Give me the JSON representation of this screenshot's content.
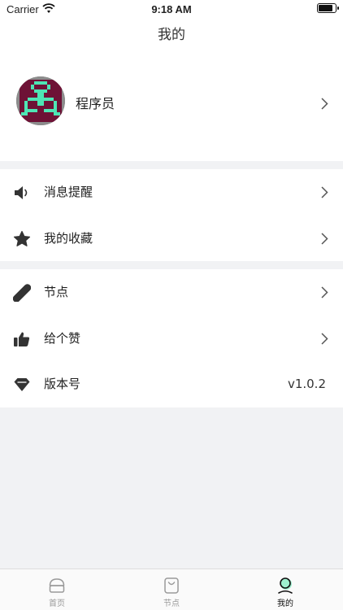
{
  "status_bar": {
    "carrier": "Carrier",
    "time": "9:18 AM"
  },
  "nav": {
    "title": "我的"
  },
  "profile": {
    "name": "程序员"
  },
  "menu": {
    "group1": [
      {
        "label": "消息提醒",
        "icon": "speaker-icon"
      },
      {
        "label": "我的收藏",
        "icon": "star-icon"
      }
    ],
    "group2": [
      {
        "label": "节点",
        "icon": "pill-icon"
      },
      {
        "label": "给个赞",
        "icon": "thumbs-up-icon"
      },
      {
        "label": "版本号",
        "icon": "diamond-icon",
        "value": "v1.0.2"
      }
    ]
  },
  "tabs": [
    {
      "label": "首页",
      "icon": "home-icon",
      "active": false
    },
    {
      "label": "节点",
      "icon": "bag-icon",
      "active": false
    },
    {
      "label": "我的",
      "icon": "person-icon",
      "active": true
    }
  ],
  "colors": {
    "icon": "#333333",
    "accent": "#4ee6b4",
    "avatar_bg": "#6e1236",
    "background": "#f1f2f4"
  }
}
